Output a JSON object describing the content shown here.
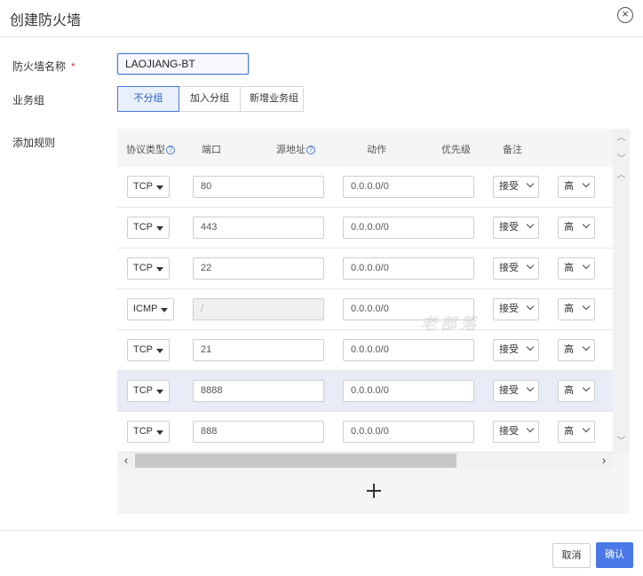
{
  "dialog": {
    "title": "创建防火墙",
    "close_icon": "close-circle-icon"
  },
  "form": {
    "name_label": "防火墙名称",
    "required_mark": "*",
    "name_value": "LAOJIANG-BT",
    "group_label": "业务组",
    "group_options": [
      "不分组",
      "加入分组",
      "新增业务组"
    ],
    "group_selected": "不分组",
    "rules_label": "添加规则"
  },
  "rules": {
    "columns": {
      "protocol": "协议类型",
      "port": "端口",
      "source": "源地址",
      "action": "动作",
      "priority": "优先级",
      "remark": "备注",
      "help_icon": "?"
    },
    "rows": [
      {
        "protocol": "TCP",
        "port": "80",
        "source": "0.0.0.0/0",
        "action": "接受",
        "priority": "高"
      },
      {
        "protocol": "TCP",
        "port": "443",
        "source": "0.0.0.0/0",
        "action": "接受",
        "priority": "高"
      },
      {
        "protocol": "TCP",
        "port": "22",
        "source": "0.0.0.0/0",
        "action": "接受",
        "priority": "高"
      },
      {
        "protocol": "ICMP",
        "port": "/",
        "source": "0.0.0.0/0",
        "action": "接受",
        "priority": "高"
      },
      {
        "protocol": "TCP",
        "port": "21",
        "source": "0.0.0.0/0",
        "action": "接受",
        "priority": "高"
      },
      {
        "protocol": "TCP",
        "port": "8888",
        "source": "0.0.0.0/0",
        "action": "接受",
        "priority": "高"
      },
      {
        "protocol": "TCP",
        "port": "888",
        "source": "0.0.0.0/0",
        "action": "接受",
        "priority": "高"
      }
    ],
    "highlighted_row": 5,
    "add_icon": "plus-icon"
  },
  "watermark": "老部落",
  "footer": {
    "cancel_label": "取消",
    "confirm_label": "确认"
  },
  "colors": {
    "accent": "#4a78e6",
    "required": "#e33333",
    "highlight_row": "#e8ecf7"
  }
}
